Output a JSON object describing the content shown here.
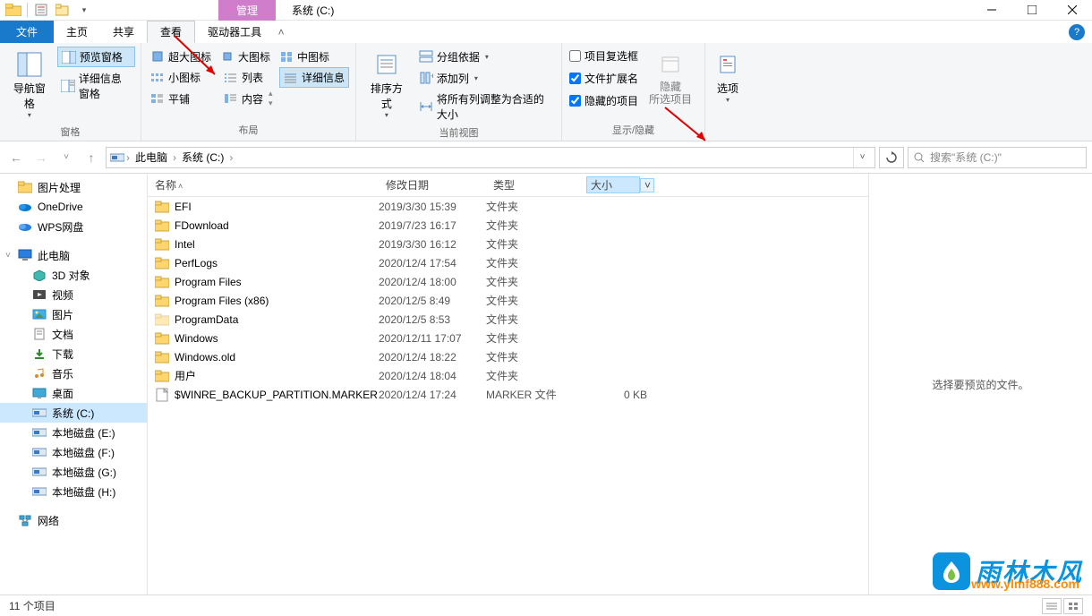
{
  "title": "系统 (C:)",
  "manage_tab": "管理",
  "tabs": {
    "file": "文件",
    "home": "主页",
    "share": "共享",
    "view": "查看",
    "drive": "驱动器工具"
  },
  "ribbon": {
    "panes": {
      "nav_pane": "导航窗格",
      "preview_pane": "预览窗格",
      "details_pane": "详细信息窗格",
      "group_label": "窗格"
    },
    "layout": {
      "extra_large": "超大图标",
      "large": "大图标",
      "medium": "中图标",
      "small": "小图标",
      "list": "列表",
      "details": "详细信息",
      "tiles": "平铺",
      "content": "内容",
      "group_label": "布局"
    },
    "current_view": {
      "sort_by": "排序方式",
      "group_by": "分组依据",
      "add_columns": "添加列",
      "size_all": "将所有列调整为合适的大小",
      "group_label": "当前视图"
    },
    "show_hide": {
      "item_checkboxes": "项目复选框",
      "file_ext": "文件扩展名",
      "hidden_items": "隐藏的项目",
      "hide_selected": "隐藏\n所选项目",
      "hide_selected_l1": "隐藏",
      "hide_selected_l2": "所选项目",
      "group_label": "显示/隐藏"
    },
    "options": "选项"
  },
  "breadcrumb": {
    "this_pc": "此电脑",
    "drive": "系统 (C:)"
  },
  "search_placeholder": "搜索\"系统 (C:)\"",
  "columns": {
    "name": "名称",
    "date": "修改日期",
    "type": "类型",
    "size": "大小"
  },
  "rows": [
    {
      "icon": "folder",
      "name": "EFI",
      "date": "2019/3/30 15:39",
      "type": "文件夹",
      "size": ""
    },
    {
      "icon": "folder",
      "name": "FDownload",
      "date": "2019/7/23 16:17",
      "type": "文件夹",
      "size": ""
    },
    {
      "icon": "folder",
      "name": "Intel",
      "date": "2019/3/30 16:12",
      "type": "文件夹",
      "size": ""
    },
    {
      "icon": "folder",
      "name": "PerfLogs",
      "date": "2020/12/4 17:54",
      "type": "文件夹",
      "size": ""
    },
    {
      "icon": "folder",
      "name": "Program Files",
      "date": "2020/12/4 18:00",
      "type": "文件夹",
      "size": ""
    },
    {
      "icon": "folder",
      "name": "Program Files (x86)",
      "date": "2020/12/5 8:49",
      "type": "文件夹",
      "size": ""
    },
    {
      "icon": "folder-faded",
      "name": "ProgramData",
      "date": "2020/12/5 8:53",
      "type": "文件夹",
      "size": ""
    },
    {
      "icon": "folder",
      "name": "Windows",
      "date": "2020/12/11 17:07",
      "type": "文件夹",
      "size": ""
    },
    {
      "icon": "folder",
      "name": "Windows.old",
      "date": "2020/12/4 18:22",
      "type": "文件夹",
      "size": ""
    },
    {
      "icon": "folder",
      "name": "用户",
      "date": "2020/12/4 18:04",
      "type": "文件夹",
      "size": ""
    },
    {
      "icon": "file",
      "name": "$WINRE_BACKUP_PARTITION.MARKER",
      "date": "2020/12/4 17:24",
      "type": "MARKER 文件",
      "size": "0 KB"
    }
  ],
  "sidebar": {
    "items": [
      {
        "icon": "folder",
        "label": "图片处理",
        "level": 1
      },
      {
        "icon": "onedrive",
        "label": "OneDrive",
        "level": 1
      },
      {
        "icon": "wps",
        "label": "WPS网盘",
        "level": 1
      },
      {
        "spacer": true
      },
      {
        "icon": "thispc",
        "label": "此电脑",
        "level": 1,
        "expandable": true
      },
      {
        "icon": "3d",
        "label": "3D 对象",
        "level": 2
      },
      {
        "icon": "video",
        "label": "视频",
        "level": 2
      },
      {
        "icon": "pictures",
        "label": "图片",
        "level": 2
      },
      {
        "icon": "documents",
        "label": "文档",
        "level": 2
      },
      {
        "icon": "downloads",
        "label": "下载",
        "level": 2
      },
      {
        "icon": "music",
        "label": "音乐",
        "level": 2
      },
      {
        "icon": "desktop",
        "label": "桌面",
        "level": 2
      },
      {
        "icon": "drive",
        "label": "系统 (C:)",
        "level": 2,
        "selected": true
      },
      {
        "icon": "drive",
        "label": "本地磁盘 (E:)",
        "level": 2
      },
      {
        "icon": "drive",
        "label": "本地磁盘 (F:)",
        "level": 2
      },
      {
        "icon": "drive",
        "label": "本地磁盘 (G:)",
        "level": 2
      },
      {
        "icon": "drive",
        "label": "本地磁盘 (H:)",
        "level": 2
      },
      {
        "spacer": true
      },
      {
        "icon": "network",
        "label": "网络",
        "level": 1
      }
    ]
  },
  "preview_empty": "选择要预览的文件。",
  "status": "11 个项目",
  "watermark": {
    "cn": "雨林木风",
    "url": "www.ylmf888.com"
  }
}
